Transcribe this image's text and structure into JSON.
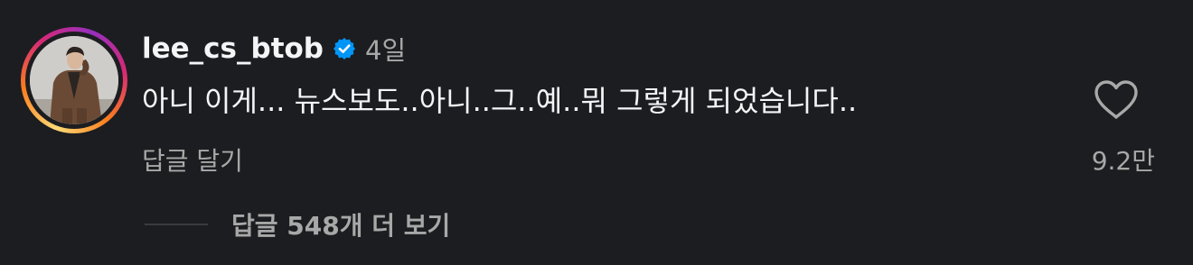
{
  "comment": {
    "username": "lee_cs_btob",
    "verified_icon": "verified-badge-icon",
    "time": "4일",
    "text": "아니 이게... 뉴스보도..아니..그..예..뭐 그렇게 되었습니다..",
    "reply_label": "답글 달기",
    "like_icon": "heart-icon",
    "like_count": "9.2만",
    "view_replies_label": "답글 548개 더 보기"
  },
  "colors": {
    "background": "#1c1d20",
    "primary_text": "#f3f5f7",
    "secondary_text": "#a8a8a8",
    "verified_blue": "#0095f6"
  }
}
